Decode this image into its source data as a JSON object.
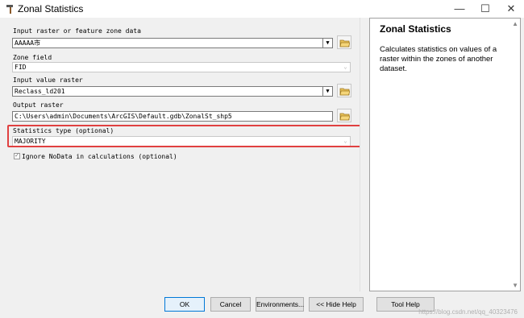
{
  "window": {
    "title": "Zonal Statistics",
    "minimize": "—",
    "maximize": "☐",
    "close": "✕"
  },
  "form": {
    "zone_data": {
      "label": "Input raster or feature zone data",
      "value": "AAAAA市"
    },
    "zone_field": {
      "label": "Zone field",
      "value": "FID"
    },
    "value_raster": {
      "label": "Input value raster",
      "value": "Reclass_ld201"
    },
    "output_raster": {
      "label": "Output raster",
      "value": "C:\\Users\\admin\\Documents\\ArcGIS\\Default.gdb\\ZonalSt_shp5"
    },
    "statistics_type": {
      "label": "Statistics type (optional)",
      "value": "MAJORITY"
    },
    "ignore_nodata": {
      "label": "Ignore NoData in calculations (optional)",
      "checked": true
    }
  },
  "help": {
    "title": "Zonal Statistics",
    "text": "Calculates statistics on values of a raster within the zones of another dataset."
  },
  "buttons": {
    "ok": "OK",
    "cancel": "Cancel",
    "environments": "Environments...",
    "hide_help": "<< Hide Help",
    "tool_help": "Tool Help"
  },
  "watermark": "https://blog.csdn.net/qq_40323476",
  "colors": {
    "highlight": "#e04040",
    "accent": "#0078d7"
  }
}
